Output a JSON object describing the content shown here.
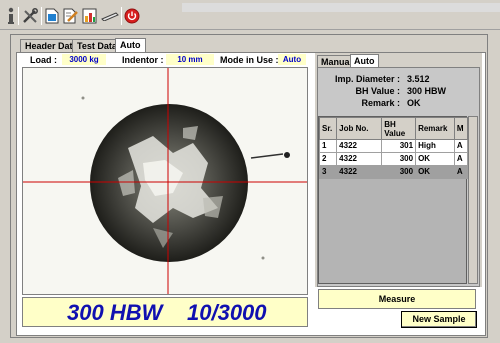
{
  "toolbar": {
    "icons": [
      "info-icon",
      "tools-icon",
      "document-icon",
      "edit-document-icon",
      "chart-icon",
      "pen-icon",
      "power-icon"
    ],
    "colors": {
      "power": "#d81e1e",
      "chart": "#e8a020",
      "document": "#2080d0"
    }
  },
  "tabs": [
    {
      "label": "Header Data"
    },
    {
      "label": "Test Data"
    },
    {
      "label": "Auto"
    }
  ],
  "info": {
    "load_label": "Load :",
    "load_value": "3000 kg",
    "indentor_label": "Indentor :",
    "indentor_value": "10 mm",
    "mode_label": "Mode in Use :",
    "mode_value": "Auto"
  },
  "result": {
    "hardness": "300 HBW",
    "scale": "10/3000"
  },
  "right": {
    "tabs": [
      {
        "label": "Manual"
      },
      {
        "label": "Auto"
      }
    ],
    "imp_diameter_label": "Imp. Diameter :",
    "imp_diameter_value": "3.512",
    "bh_label": "BH Value :",
    "bh_value": "300 HBW",
    "remark_label": "Remark :",
    "remark_value": "OK"
  },
  "table": {
    "headers": [
      "Sr.",
      "Job No.",
      "BH\nValue",
      "Remark",
      "M"
    ],
    "rows": [
      {
        "sr": "1",
        "job": "4322",
        "bh": "301",
        "remark": "High",
        "m": "A"
      },
      {
        "sr": "2",
        "job": "4322",
        "bh": "300",
        "remark": "OK",
        "m": "A"
      },
      {
        "sr": "3",
        "job": "4322",
        "bh": "300",
        "remark": "OK",
        "m": "A"
      }
    ]
  },
  "buttons": {
    "measure": "Measure",
    "new_sample": "New Sample"
  },
  "colors": {
    "field_bg": "#ffffc8",
    "result_text": "#1010b0",
    "crosshair": "#cc0000"
  }
}
